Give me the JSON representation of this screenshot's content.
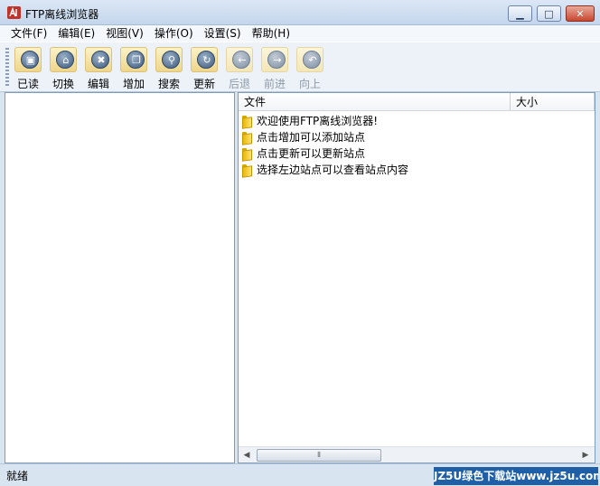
{
  "window": {
    "title": "FTP离线浏览器",
    "minimize_glyph": "▁",
    "maximize_glyph": "□",
    "close_glyph": "✕"
  },
  "menu": {
    "items": [
      "文件(F)",
      "编辑(E)",
      "视图(V)",
      "操作(O)",
      "设置(S)",
      "帮助(H)"
    ]
  },
  "toolbar": {
    "buttons": [
      {
        "label": "已读",
        "icon": "read-icon",
        "glyph": "▣",
        "enabled": true
      },
      {
        "label": "切换",
        "icon": "home-icon",
        "glyph": "⌂",
        "enabled": true
      },
      {
        "label": "编辑",
        "icon": "edit-icon",
        "glyph": "✖",
        "enabled": true
      },
      {
        "label": "增加",
        "icon": "add-icon",
        "glyph": "❐",
        "enabled": true
      },
      {
        "label": "搜索",
        "icon": "search-icon",
        "glyph": "⚲",
        "enabled": true
      },
      {
        "label": "更新",
        "icon": "refresh-icon",
        "glyph": "↻",
        "enabled": true
      },
      {
        "label": "后退",
        "icon": "back-icon",
        "glyph": "←",
        "enabled": false
      },
      {
        "label": "前进",
        "icon": "forward-icon",
        "glyph": "→",
        "enabled": false
      },
      {
        "label": "向上",
        "icon": "up-icon",
        "glyph": "↶",
        "enabled": false
      }
    ]
  },
  "file_list": {
    "columns": [
      "文件",
      "大小"
    ],
    "rows": [
      "欢迎使用FTP离线浏览器!",
      "点击增加可以添加站点",
      "点击更新可以更新站点",
      "选择左边站点可以查看站点内容"
    ],
    "scroll_left_glyph": "◀",
    "scroll_right_glyph": "▶",
    "scroll_thumb_glyph": "⦀"
  },
  "status": {
    "text": "就绪",
    "watermark": "JZ5U绿色下载站www.jz5u.com"
  },
  "colors": {
    "frame": "#d9e4f1",
    "toolbar_button": "#eed58a",
    "watermark_bg": "#1f5fa8"
  }
}
